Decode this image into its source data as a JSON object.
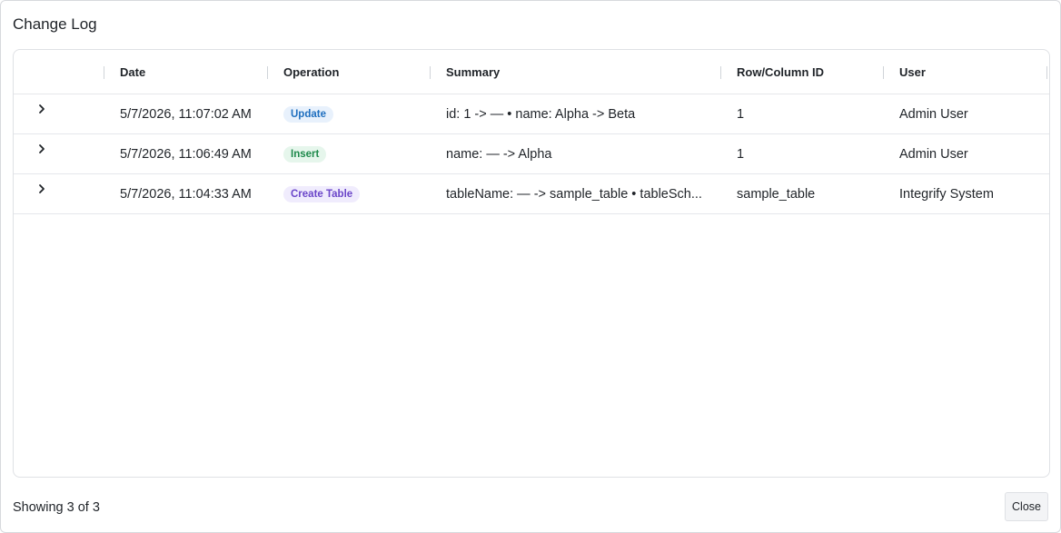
{
  "dialog": {
    "title": "Change Log"
  },
  "table": {
    "columns": {
      "date": "Date",
      "operation": "Operation",
      "summary": "Summary",
      "row_column_id": "Row/Column ID",
      "user": "User"
    },
    "rows": [
      {
        "date": "5/7/2026, 11:07:02 AM",
        "operation": "Update",
        "summary": "id: 1 -> — • name: Alpha -> Beta",
        "row_column_id": "1",
        "user": "Admin User"
      },
      {
        "date": "5/7/2026, 11:06:49 AM",
        "operation": "Insert",
        "summary": "name: — -> Alpha",
        "row_column_id": "1",
        "user": "Admin User"
      },
      {
        "date": "5/7/2026, 11:04:33 AM",
        "operation": "Create Table",
        "summary": "tableName: — -> sample_table • tableSch...",
        "row_column_id": "sample_table",
        "user": "Integrify System"
      }
    ]
  },
  "badge_colors": {
    "Update": {
      "bg": "#e8f1fc",
      "fg": "#1f6fbf"
    },
    "Insert": {
      "bg": "#e6f6ec",
      "fg": "#1f8a4c"
    },
    "Create Table": {
      "bg": "#f0ecfd",
      "fg": "#6b46c9"
    }
  },
  "footer": {
    "status": "Showing 3 of 3",
    "close_label": "Close"
  }
}
